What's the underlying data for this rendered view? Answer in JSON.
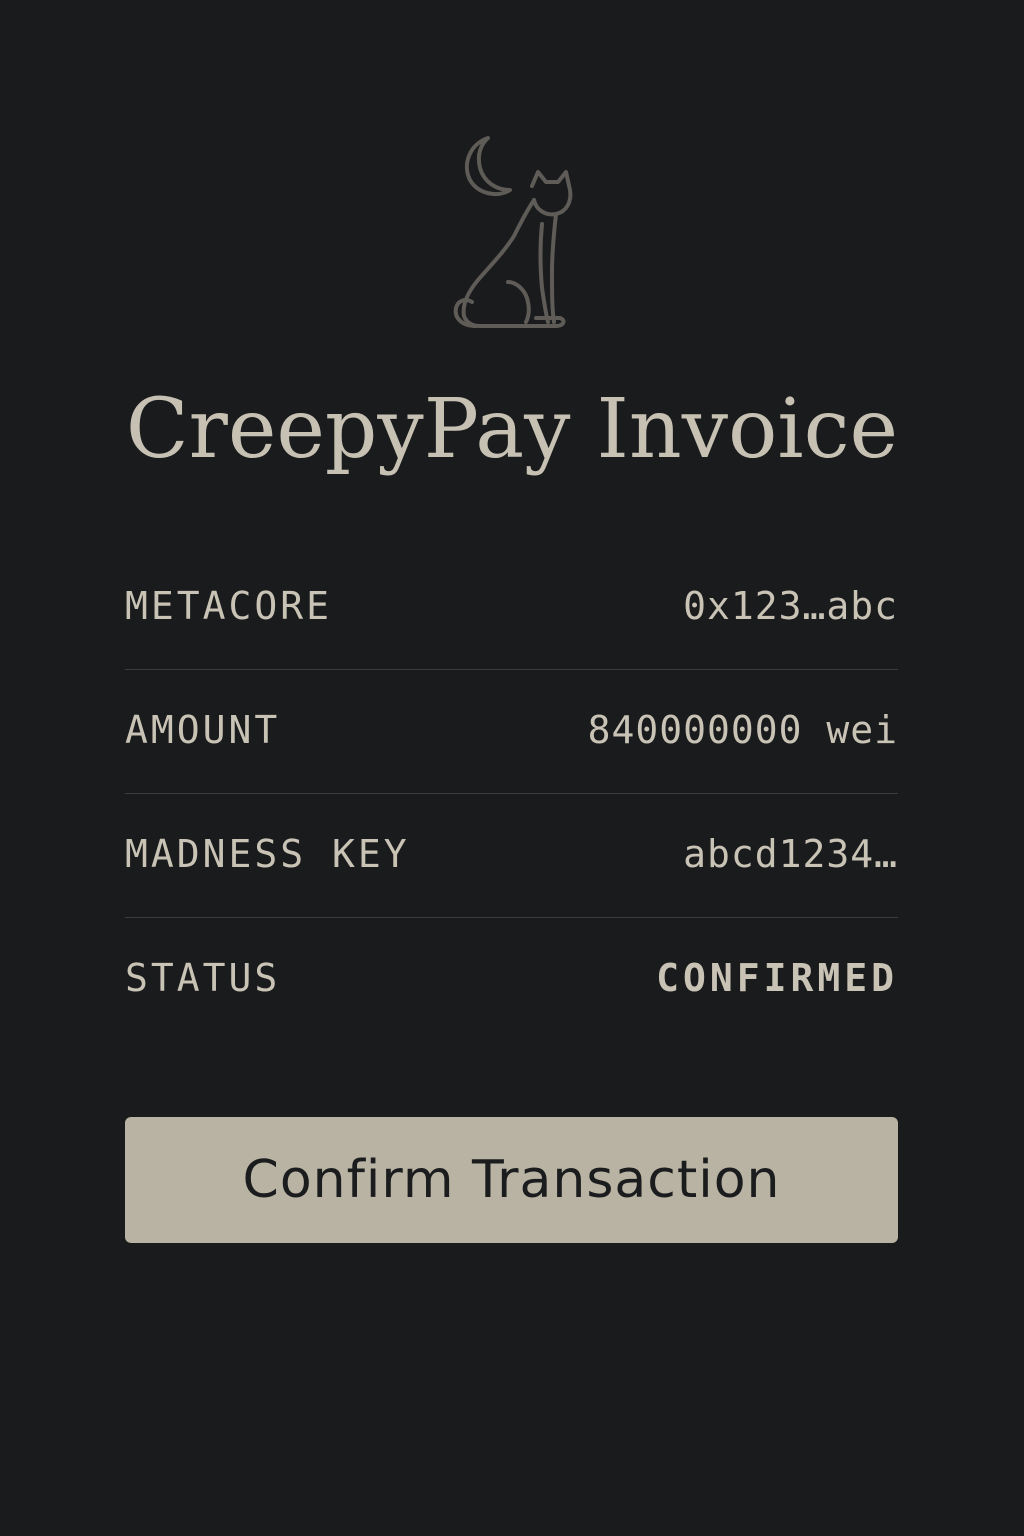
{
  "header": {
    "logo_icon": "moon-cat-icon",
    "title": "CreepyPay Invoice"
  },
  "details": [
    {
      "label": "METACORE",
      "value": "0x123…abc"
    },
    {
      "label": "AMOUNT",
      "value": "840000000 wei"
    },
    {
      "label": "MADNESS KEY",
      "value": "abcd1234…"
    },
    {
      "label": "STATUS",
      "value": "CONFIRMED"
    }
  ],
  "actions": {
    "confirm_label": "Confirm Transaction"
  },
  "colors": {
    "background": "#1a1b1d",
    "text": "#c9c3b6",
    "button_background": "#b9b3a4",
    "button_text": "#1b1c1e",
    "divider": "#3b3c3f",
    "logo_stroke": "#5f5c57"
  }
}
